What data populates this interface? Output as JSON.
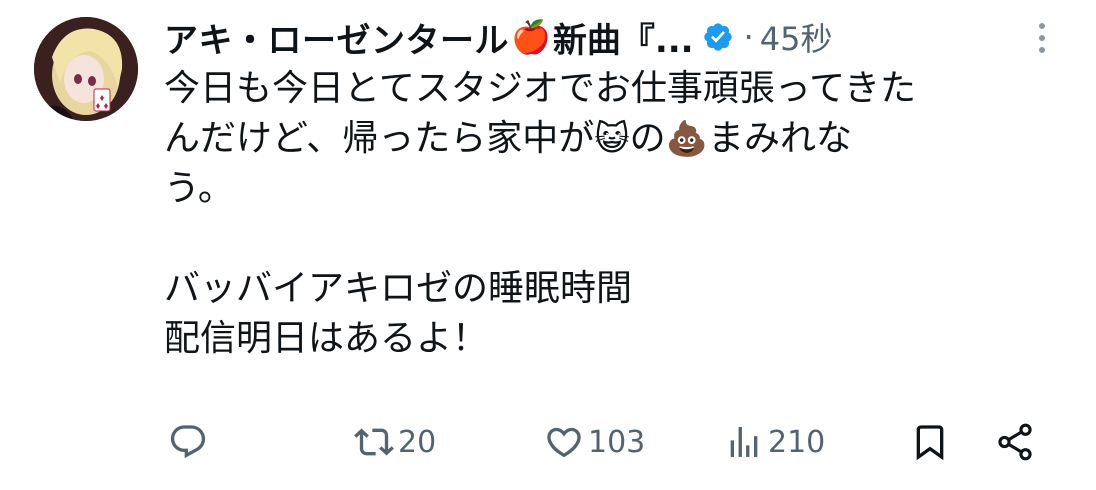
{
  "tweet": {
    "display_name": "アキ・ローゼンタール",
    "name_emoji": "🍎",
    "display_name_suffix": "新曲『...",
    "separator": "·",
    "timestamp": "45秒",
    "text_line1": "今日も今日とてスタジオでお仕事頑張ってきた",
    "text_line2_a": "んだけど、帰ったら家中が",
    "cat_emoji": "😺",
    "text_line2_b": "の",
    "poop_emoji": "💩",
    "text_line2_c": "まみれな",
    "text_line3": "う。",
    "text_line4": "バッバイアキロゼの睡眠時間",
    "text_line5": "配信明日はあるよ！"
  },
  "actions": {
    "reply_count": "",
    "retweet_count": "20",
    "like_count": "103",
    "views_count": "210"
  },
  "colors": {
    "text": "#0f1419",
    "secondary": "#536471",
    "verified": "#1d9bf0"
  },
  "icons": [
    "reply-icon",
    "retweet-icon",
    "like-icon",
    "views-icon",
    "bookmark-icon",
    "share-icon",
    "more-icon",
    "verified-badge-icon"
  ]
}
